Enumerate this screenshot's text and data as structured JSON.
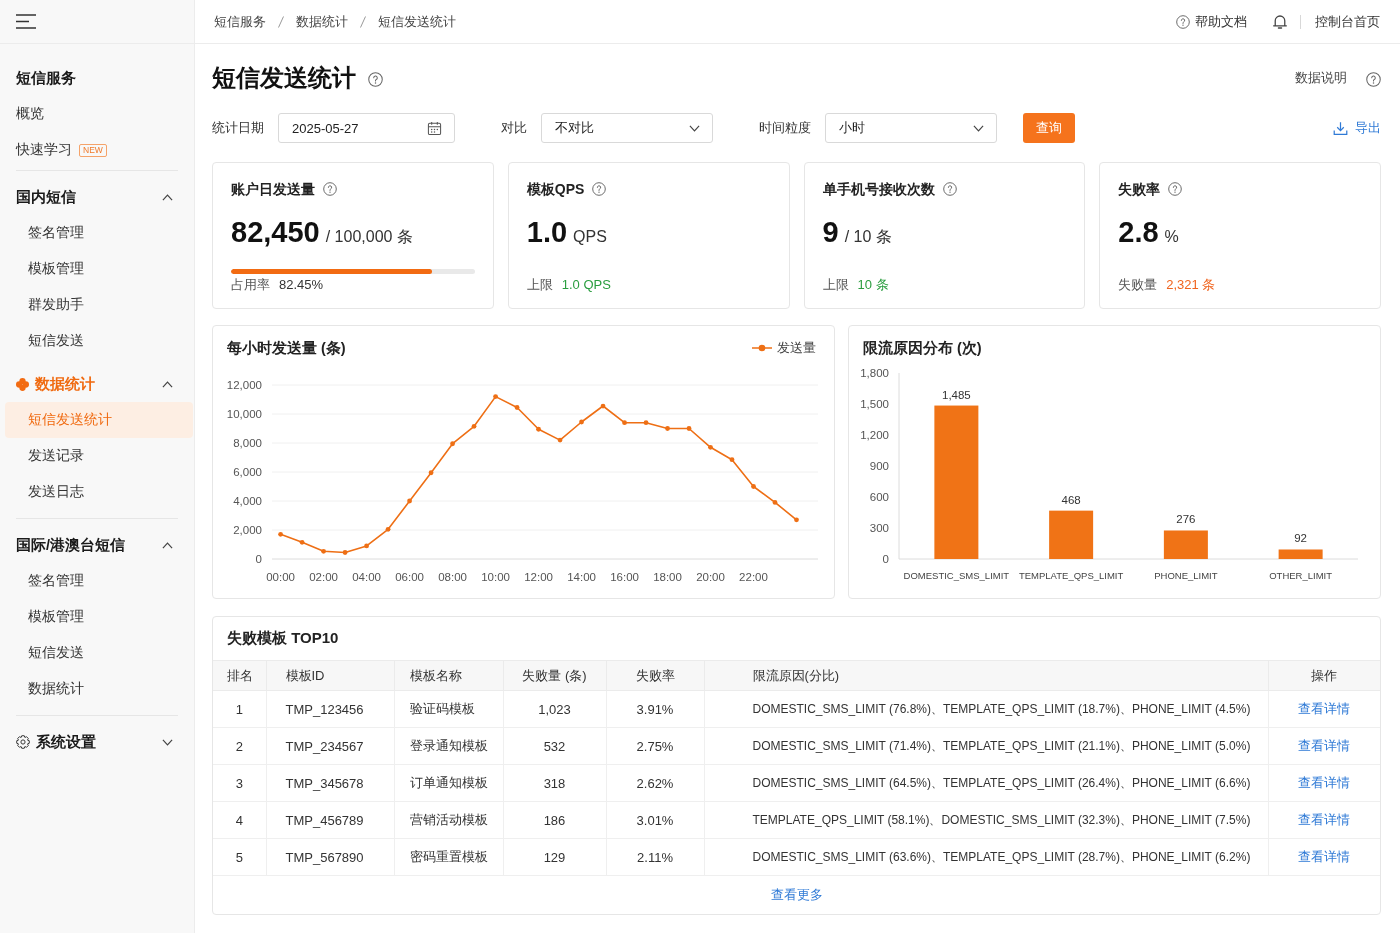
{
  "sidebar": {
    "sections": [
      {
        "items": [
          {
            "kind": "heading",
            "label": "短信服务"
          },
          {
            "kind": "link",
            "label": "概览",
            "selected": false
          },
          {
            "kind": "link",
            "label": "快速学习",
            "badge": "NEW",
            "selected": false
          }
        ]
      },
      {
        "items": [
          {
            "kind": "group",
            "label": "国内短信",
            "active": false,
            "expanded": true,
            "children": [
              {
                "label": "签名管理",
                "selected": false
              },
              {
                "label": "模板管理",
                "selected": false
              },
              {
                "label": "群发助手",
                "selected": false
              },
              {
                "label": "短信发送",
                "selected": false
              }
            ]
          },
          {
            "kind": "group",
            "label": "数据统计",
            "active": true,
            "expanded": true,
            "children": [
              {
                "label": "短信发送统计",
                "selected": true
              },
              {
                "label": "发送记录",
                "selected": false
              },
              {
                "label": "发送日志",
                "selected": false
              }
            ]
          }
        ]
      },
      {
        "items": [
          {
            "kind": "group",
            "label": "国际/港澳台短信",
            "active": false,
            "expanded": true,
            "children": [
              {
                "label": "签名管理",
                "selected": false
              },
              {
                "label": "模板管理",
                "selected": false
              },
              {
                "label": "短信发送",
                "selected": false
              },
              {
                "label": "数据统计",
                "selected": false
              }
            ]
          }
        ]
      },
      {
        "items": [
          {
            "kind": "settings",
            "label": "系统设置",
            "active": false,
            "expanded": false
          }
        ]
      }
    ]
  },
  "top_bar": {
    "breadcrumb": [
      "短信服务",
      "数据统计",
      "短信发送统计"
    ],
    "help_link": "帮助文档",
    "console_link": "控制台首页"
  },
  "page": {
    "title": "短信发送统计",
    "info_link": "数据说明"
  },
  "filters": {
    "fields": [
      {
        "kind": "date",
        "label": "统计日期",
        "value": "2025-05-27"
      },
      {
        "kind": "select",
        "label": "对比",
        "value": "不对比"
      },
      {
        "kind": "select",
        "label": "时间粒度",
        "value": "小时"
      }
    ],
    "query_button": "查询",
    "export_button": "导出"
  },
  "stat_cards": [
    {
      "title": "账户日发送量",
      "value": "82,450",
      "unit": "/ 100,000 条",
      "level": 0.8245,
      "footer_label": "占用率",
      "footer_value": "82.45%",
      "color": "#333333"
    },
    {
      "title": "模板QPS",
      "value": "1.0",
      "unit": "QPS",
      "footer_label": "上限",
      "footer_value": "1.0 QPS",
      "color": "#2a9d3f"
    },
    {
      "title": "单手机号接收次数",
      "value": "9",
      "unit": "/ 10 条",
      "footer_label": "上限",
      "footer_value": "10 条",
      "color": "#2a9d3f"
    },
    {
      "title": "失败率",
      "value": "2.8",
      "unit": "%",
      "footer_label": "失败量",
      "footer_value": "2,321 条",
      "color": "#f0641e"
    }
  ],
  "hourly_chart": {
    "chart_data": {
      "type": "line",
      "title": "每小时发送量 (条)",
      "x": [
        0,
        1,
        2,
        3,
        4,
        5,
        6,
        7,
        8,
        9,
        10,
        11,
        12,
        13,
        14,
        15,
        16,
        17,
        18,
        19,
        20,
        21,
        22,
        23,
        24
      ],
      "series": [
        {
          "name": "发送量",
          "color": "#ee6f15",
          "values": [
            1700,
            1150,
            530,
            450,
            900,
            2050,
            4000,
            5950,
            7950,
            9150,
            11200,
            10450,
            8950,
            8200,
            9450,
            10550,
            9400,
            9400,
            9000,
            9000,
            7700,
            6850,
            5000,
            3900,
            2700
          ]
        }
      ],
      "xlim": [
        -0.4,
        25
      ],
      "ylim": [
        0,
        12000
      ],
      "xticks": [
        {
          "value": 0,
          "label": "00:00"
        },
        {
          "value": 2,
          "label": "02:00"
        },
        {
          "value": 4,
          "label": "04:00"
        },
        {
          "value": 6,
          "label": "06:00"
        },
        {
          "value": 8,
          "label": "08:00"
        },
        {
          "value": 10,
          "label": "10:00"
        },
        {
          "value": 12,
          "label": "12:00"
        },
        {
          "value": 14,
          "label": "14:00"
        },
        {
          "value": 16,
          "label": "16:00"
        },
        {
          "value": 18,
          "label": "18:00"
        },
        {
          "value": 20,
          "label": "20:00"
        },
        {
          "value": 22,
          "label": "22:00"
        }
      ],
      "yticks": [
        0,
        {
          "value": 2000,
          "label": "2,000"
        },
        {
          "value": 4000,
          "label": "4,000"
        },
        {
          "value": 6000,
          "label": "6,000"
        },
        {
          "value": 8000,
          "label": "8,000"
        },
        {
          "value": 10000,
          "label": "10,000"
        },
        {
          "value": 12000,
          "label": "12,000"
        }
      ],
      "grid": true
    }
  },
  "limit_chart": {
    "chart_data": {
      "type": "bar",
      "title": "限流原因分布 (次)",
      "categories": [
        "DOMESTIC_SMS_LIMIT",
        "TEMPLATE_QPS_LIMIT",
        "PHONE_LIMIT",
        "OTHER_LIMIT"
      ],
      "values": [
        1485,
        468,
        276,
        92
      ],
      "ylim": [
        0,
        1800
      ],
      "yticks": [
        0,
        300,
        600,
        900,
        {
          "value": 1200,
          "label": "1,200"
        },
        {
          "value": 1500,
          "label": "1,500"
        },
        {
          "value": 1800,
          "label": "1,800"
        }
      ],
      "value_labels": [
        "1,485",
        "468",
        "276",
        "92"
      ]
    }
  },
  "failed_templates": {
    "title": "失败模板 TOP10",
    "columns": [
      "排名",
      "模板ID",
      "模板名称",
      "失败量 (条)",
      "失败率",
      "限流原因(分比)",
      "操作"
    ],
    "rows": [
      {
        "cells": [
          "1",
          "TMP_123456",
          "验证码模板",
          "1,023",
          "3.91%",
          "DOMESTIC_SMS_LIMIT (76.8%)、TEMPLATE_QPS_LIMIT (18.7%)、PHONE_LIMIT (4.5%)"
        ],
        "action": "查看详情"
      },
      {
        "cells": [
          "2",
          "TMP_234567",
          "登录通知模板",
          "532",
          "2.75%",
          "DOMESTIC_SMS_LIMIT (71.4%)、TEMPLATE_QPS_LIMIT (21.1%)、PHONE_LIMIT (5.0%)"
        ],
        "action": "查看详情"
      },
      {
        "cells": [
          "3",
          "TMP_345678",
          "订单通知模板",
          "318",
          "2.62%",
          "DOMESTIC_SMS_LIMIT (64.5%)、TEMPLATE_QPS_LIMIT (26.4%)、PHONE_LIMIT (6.6%)"
        ],
        "action": "查看详情"
      },
      {
        "cells": [
          "4",
          "TMP_456789",
          "营销活动模板",
          "186",
          "3.01%",
          "TEMPLATE_QPS_LIMIT (58.1%)、DOMESTIC_SMS_LIMIT (32.3%)、PHONE_LIMIT (7.5%)"
        ],
        "action": "查看详情"
      },
      {
        "cells": [
          "5",
          "TMP_567890",
          "密码重置模板",
          "129",
          "2.11%",
          "DOMESTIC_SMS_LIMIT (63.6%)、TEMPLATE_QPS_LIMIT (28.7%)、PHONE_LIMIT (6.2%)"
        ],
        "action": "查看详情"
      }
    ],
    "more_link": "查看更多"
  }
}
